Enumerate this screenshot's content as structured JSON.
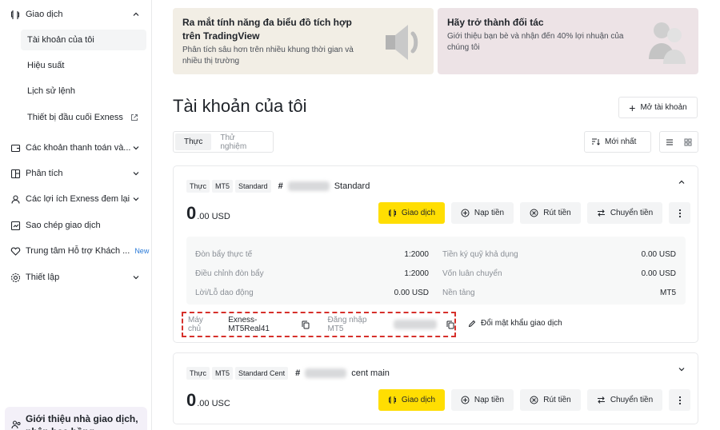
{
  "sidebar": {
    "items": [
      {
        "label": "Giao dịch"
      },
      {
        "label": "Tài khoản của tôi"
      },
      {
        "label": "Hiệu suất"
      },
      {
        "label": "Lịch sử lệnh"
      },
      {
        "label": "Thiết bị đầu cuối Exness"
      },
      {
        "label": "Các khoản thanh toán và..."
      },
      {
        "label": "Phân tích"
      },
      {
        "label": "Các lợi ích Exness đem lại"
      },
      {
        "label": "Sao chép giao dịch"
      },
      {
        "label": "Trung tâm Hỗ trợ Khách ...",
        "badge": "New"
      },
      {
        "label": "Thiết lập"
      }
    ],
    "promo": "Giới thiệu nhà giao dịch, nhận hoa hồng"
  },
  "banners": [
    {
      "title": "Ra mắt tính năng đa biểu đồ tích hợp trên TradingView",
      "text": "Phân tích sâu hơn trên nhiều khung thời gian và nhiều thị trường",
      "bg": "#f2eee5"
    },
    {
      "title": "Hãy trở thành đối tác",
      "text": "Giới thiệu bạn bè và nhận đến 40% lợi nhuận của chúng tôi",
      "bg": "#ede3e6"
    }
  ],
  "page": {
    "title": "Tài khoản của tôi",
    "open_account": "Mở tài khoản",
    "tabs": [
      "Thực",
      "Thử nghiệm"
    ],
    "sort_label": "Mới nhất"
  },
  "accounts": [
    {
      "tags": [
        "Thực",
        "MT5",
        "Standard"
      ],
      "hash": "#",
      "name": "Standard",
      "balance_int": "0",
      "balance_dec": ".00 USD",
      "actions": [
        "Giao dịch",
        "Nạp tiền",
        "Rút tiền",
        "Chuyển tiền"
      ],
      "info_left": [
        {
          "label": "Đòn bẩy thực tế",
          "value": "1:2000"
        },
        {
          "label": "Điều chỉnh đòn bẩy",
          "value": "1:2000"
        },
        {
          "label": "Lời/Lỗ dao động",
          "value": "0.00 USD"
        }
      ],
      "info_right": [
        {
          "label": "Tiền ký quỹ khả dụng",
          "value": "0.00 USD"
        },
        {
          "label": "Vốn luân chuyển",
          "value": "0.00 USD"
        },
        {
          "label": "Nền tảng",
          "value": "MT5"
        }
      ],
      "server_label": "Máy chủ",
      "server_value": "Exness-MT5Real41",
      "login_label": "Đăng nhập MT5",
      "change_password": "Đổi mật khẩu giao dịch"
    },
    {
      "tags": [
        "Thực",
        "MT5",
        "Standard Cent"
      ],
      "hash": "#",
      "name": "cent main",
      "balance_int": "0",
      "balance_dec": ".00 USC",
      "actions": [
        "Giao dịch",
        "Nạp tiền",
        "Rút tiền",
        "Chuyển tiền"
      ]
    }
  ],
  "colors": {
    "accent": "#ffde02",
    "highlight": "#d6302b"
  }
}
